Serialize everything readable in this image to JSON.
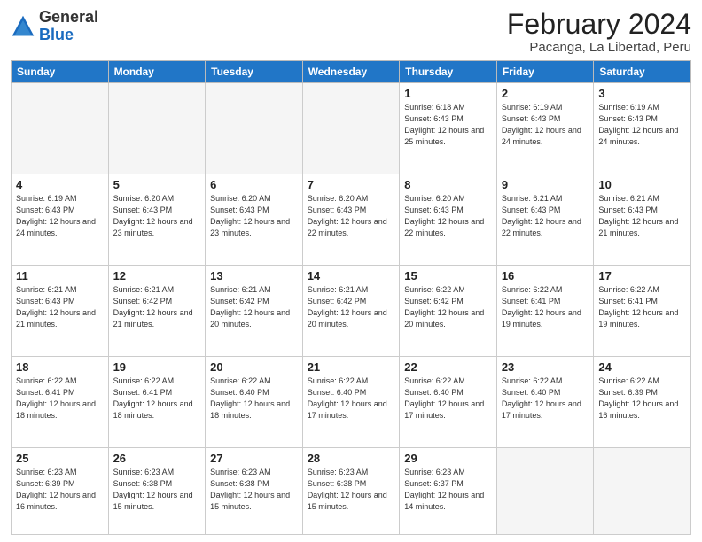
{
  "logo": {
    "general": "General",
    "blue": "Blue"
  },
  "header": {
    "title": "February 2024",
    "subtitle": "Pacanga, La Libertad, Peru"
  },
  "weekdays": [
    "Sunday",
    "Monday",
    "Tuesday",
    "Wednesday",
    "Thursday",
    "Friday",
    "Saturday"
  ],
  "weeks": [
    [
      {
        "day": "",
        "info": ""
      },
      {
        "day": "",
        "info": ""
      },
      {
        "day": "",
        "info": ""
      },
      {
        "day": "",
        "info": ""
      },
      {
        "day": "1",
        "info": "Sunrise: 6:18 AM\nSunset: 6:43 PM\nDaylight: 12 hours\nand 25 minutes."
      },
      {
        "day": "2",
        "info": "Sunrise: 6:19 AM\nSunset: 6:43 PM\nDaylight: 12 hours\nand 24 minutes."
      },
      {
        "day": "3",
        "info": "Sunrise: 6:19 AM\nSunset: 6:43 PM\nDaylight: 12 hours\nand 24 minutes."
      }
    ],
    [
      {
        "day": "4",
        "info": "Sunrise: 6:19 AM\nSunset: 6:43 PM\nDaylight: 12 hours\nand 24 minutes."
      },
      {
        "day": "5",
        "info": "Sunrise: 6:20 AM\nSunset: 6:43 PM\nDaylight: 12 hours\nand 23 minutes."
      },
      {
        "day": "6",
        "info": "Sunrise: 6:20 AM\nSunset: 6:43 PM\nDaylight: 12 hours\nand 23 minutes."
      },
      {
        "day": "7",
        "info": "Sunrise: 6:20 AM\nSunset: 6:43 PM\nDaylight: 12 hours\nand 22 minutes."
      },
      {
        "day": "8",
        "info": "Sunrise: 6:20 AM\nSunset: 6:43 PM\nDaylight: 12 hours\nand 22 minutes."
      },
      {
        "day": "9",
        "info": "Sunrise: 6:21 AM\nSunset: 6:43 PM\nDaylight: 12 hours\nand 22 minutes."
      },
      {
        "day": "10",
        "info": "Sunrise: 6:21 AM\nSunset: 6:43 PM\nDaylight: 12 hours\nand 21 minutes."
      }
    ],
    [
      {
        "day": "11",
        "info": "Sunrise: 6:21 AM\nSunset: 6:43 PM\nDaylight: 12 hours\nand 21 minutes."
      },
      {
        "day": "12",
        "info": "Sunrise: 6:21 AM\nSunset: 6:42 PM\nDaylight: 12 hours\nand 21 minutes."
      },
      {
        "day": "13",
        "info": "Sunrise: 6:21 AM\nSunset: 6:42 PM\nDaylight: 12 hours\nand 20 minutes."
      },
      {
        "day": "14",
        "info": "Sunrise: 6:21 AM\nSunset: 6:42 PM\nDaylight: 12 hours\nand 20 minutes."
      },
      {
        "day": "15",
        "info": "Sunrise: 6:22 AM\nSunset: 6:42 PM\nDaylight: 12 hours\nand 20 minutes."
      },
      {
        "day": "16",
        "info": "Sunrise: 6:22 AM\nSunset: 6:41 PM\nDaylight: 12 hours\nand 19 minutes."
      },
      {
        "day": "17",
        "info": "Sunrise: 6:22 AM\nSunset: 6:41 PM\nDaylight: 12 hours\nand 19 minutes."
      }
    ],
    [
      {
        "day": "18",
        "info": "Sunrise: 6:22 AM\nSunset: 6:41 PM\nDaylight: 12 hours\nand 18 minutes."
      },
      {
        "day": "19",
        "info": "Sunrise: 6:22 AM\nSunset: 6:41 PM\nDaylight: 12 hours\nand 18 minutes."
      },
      {
        "day": "20",
        "info": "Sunrise: 6:22 AM\nSunset: 6:40 PM\nDaylight: 12 hours\nand 18 minutes."
      },
      {
        "day": "21",
        "info": "Sunrise: 6:22 AM\nSunset: 6:40 PM\nDaylight: 12 hours\nand 17 minutes."
      },
      {
        "day": "22",
        "info": "Sunrise: 6:22 AM\nSunset: 6:40 PM\nDaylight: 12 hours\nand 17 minutes."
      },
      {
        "day": "23",
        "info": "Sunrise: 6:22 AM\nSunset: 6:40 PM\nDaylight: 12 hours\nand 17 minutes."
      },
      {
        "day": "24",
        "info": "Sunrise: 6:22 AM\nSunset: 6:39 PM\nDaylight: 12 hours\nand 16 minutes."
      }
    ],
    [
      {
        "day": "25",
        "info": "Sunrise: 6:23 AM\nSunset: 6:39 PM\nDaylight: 12 hours\nand 16 minutes."
      },
      {
        "day": "26",
        "info": "Sunrise: 6:23 AM\nSunset: 6:38 PM\nDaylight: 12 hours\nand 15 minutes."
      },
      {
        "day": "27",
        "info": "Sunrise: 6:23 AM\nSunset: 6:38 PM\nDaylight: 12 hours\nand 15 minutes."
      },
      {
        "day": "28",
        "info": "Sunrise: 6:23 AM\nSunset: 6:38 PM\nDaylight: 12 hours\nand 15 minutes."
      },
      {
        "day": "29",
        "info": "Sunrise: 6:23 AM\nSunset: 6:37 PM\nDaylight: 12 hours\nand 14 minutes."
      },
      {
        "day": "",
        "info": ""
      },
      {
        "day": "",
        "info": ""
      }
    ]
  ]
}
